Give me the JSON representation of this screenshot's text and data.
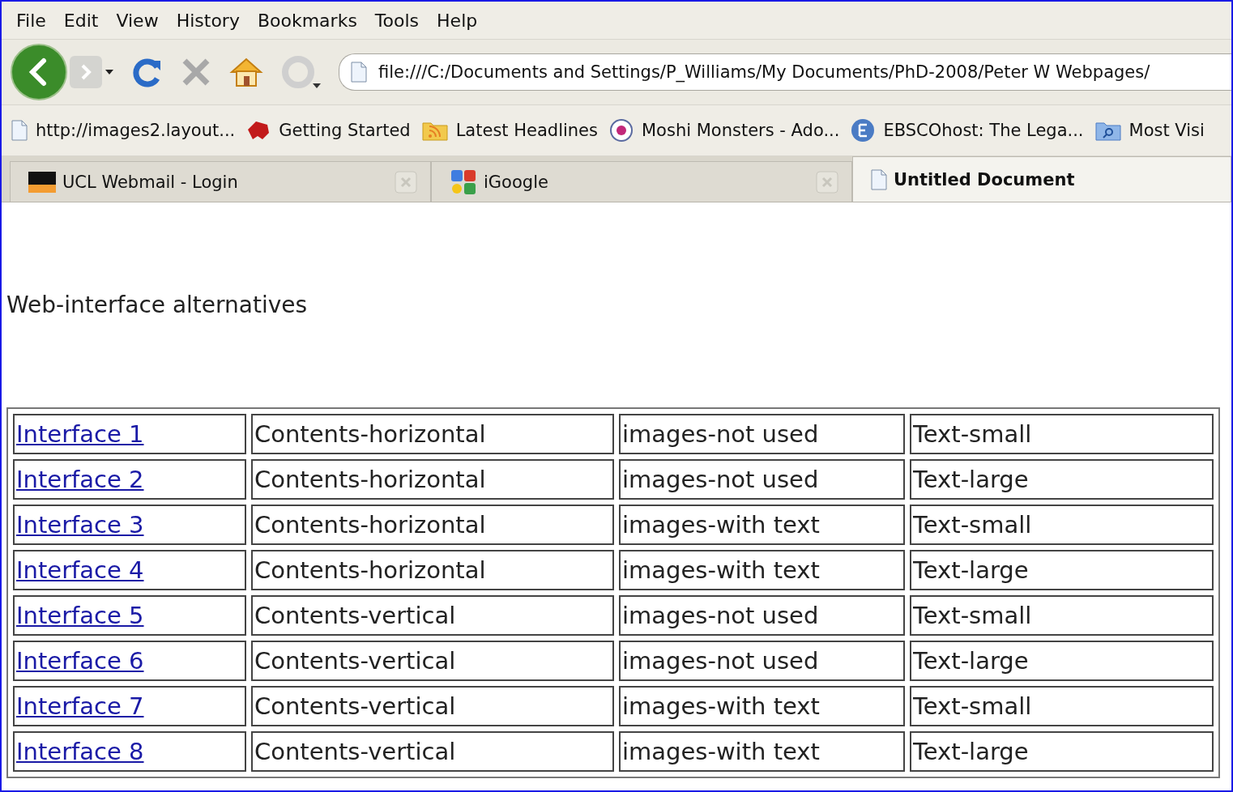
{
  "menu": [
    "File",
    "Edit",
    "View",
    "History",
    "Bookmarks",
    "Tools",
    "Help"
  ],
  "address": {
    "value": "file:///C:/Documents and Settings/P_Williams/My Documents/PhD-2008/Peter W Webpages/"
  },
  "bookmarks": [
    {
      "label": "http://images2.layout...",
      "kind": "page"
    },
    {
      "label": "Getting Started",
      "kind": "animal"
    },
    {
      "label": "Latest Headlines",
      "kind": "feed"
    },
    {
      "label": "Moshi Monsters - Ado...",
      "kind": "eye"
    },
    {
      "label": "EBSCOhost: The Lega...",
      "kind": "letter"
    },
    {
      "label": "Most Visi",
      "kind": "folder"
    }
  ],
  "tabs": [
    {
      "label": "UCL Webmail - Login",
      "kind": "ucl",
      "selected": false
    },
    {
      "label": "iGoogle",
      "kind": "google",
      "selected": false
    },
    {
      "label": "Untitled Document",
      "kind": "page",
      "selected": true
    }
  ],
  "page": {
    "heading": "Web-interface alternatives",
    "rows": [
      [
        "Interface 1",
        "Contents-horizontal",
        "images-not used",
        "Text-small"
      ],
      [
        "Interface 2",
        "Contents-horizontal",
        "images-not used",
        "Text-large"
      ],
      [
        "Interface 3",
        "Contents-horizontal",
        "images-with text",
        "Text-small"
      ],
      [
        "Interface 4",
        "Contents-horizontal",
        "images-with text",
        "Text-large"
      ],
      [
        "Interface 5",
        "Contents-vertical",
        "images-not used",
        "Text-small"
      ],
      [
        "Interface 6",
        "Contents-vertical",
        "images-not used",
        "Text-large"
      ],
      [
        "Interface 7",
        "Contents-vertical",
        "images-with text",
        "Text-small"
      ],
      [
        "Interface 8",
        "Contents-vertical",
        "images-with text",
        "Text-large"
      ]
    ]
  }
}
